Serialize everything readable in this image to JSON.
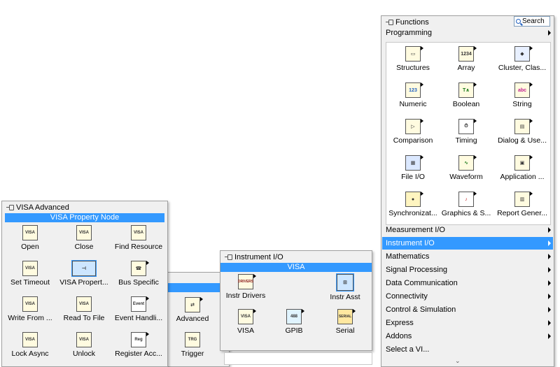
{
  "functions": {
    "title": "Functions",
    "search_label": "Search",
    "section": "Programming",
    "programming_items": [
      {
        "label": "Structures",
        "icon": "structures-icon"
      },
      {
        "label": "Array",
        "icon": "array-icon"
      },
      {
        "label": "Cluster, Clas...",
        "icon": "cluster-icon"
      },
      {
        "label": "Numeric",
        "icon": "numeric-icon"
      },
      {
        "label": "Boolean",
        "icon": "boolean-icon"
      },
      {
        "label": "String",
        "icon": "string-icon"
      },
      {
        "label": "Comparison",
        "icon": "comparison-icon"
      },
      {
        "label": "Timing",
        "icon": "timing-icon"
      },
      {
        "label": "Dialog & Use...",
        "icon": "dialog-icon"
      },
      {
        "label": "File I/O",
        "icon": "file-io-icon"
      },
      {
        "label": "Waveform",
        "icon": "waveform-icon"
      },
      {
        "label": "Application ...",
        "icon": "application-icon"
      },
      {
        "label": "Synchronizat...",
        "icon": "synchronization-icon"
      },
      {
        "label": "Graphics & S...",
        "icon": "graphics-icon"
      },
      {
        "label": "Report Gener...",
        "icon": "report-icon"
      }
    ],
    "categories": [
      "Measurement I/O",
      "Instrument I/O",
      "Mathematics",
      "Signal Processing",
      "Data Communication",
      "Connectivity",
      "Control & Simulation",
      "Express",
      "Addons",
      "Select a VI..."
    ]
  },
  "instrument_io": {
    "title": "Instrument I/O",
    "selected": "VISA",
    "items": [
      {
        "label": "Instr Drivers",
        "glyph": "DRIVERS"
      },
      {
        "label": "Instr Asst",
        "glyph": ""
      },
      {
        "label": "VISA",
        "glyph": "VISA"
      },
      {
        "label": "GPIB",
        "glyph": "488"
      },
      {
        "label": "Serial",
        "glyph": "SERIAL"
      }
    ]
  },
  "visa_mid": {
    "items": [
      {
        "label": "Advanced",
        "glyph": "⇄"
      },
      {
        "label": "Trigger",
        "glyph": "TRG"
      }
    ]
  },
  "visa_advanced": {
    "title": "VISA Advanced",
    "selected": "VISA Property Node",
    "items": [
      {
        "label": "Open",
        "glyph": "VISA"
      },
      {
        "label": "Close",
        "glyph": "VISA"
      },
      {
        "label": "Find Resource",
        "glyph": "VISA"
      },
      {
        "label": "Set Timeout",
        "glyph": "VISA"
      },
      {
        "label": "VISA Propert...",
        "glyph": "⊣"
      },
      {
        "label": "Bus Specific",
        "glyph": "☎"
      },
      {
        "label": "Write From ...",
        "glyph": "VISA"
      },
      {
        "label": "Read To File",
        "glyph": "VISA"
      },
      {
        "label": "Event Handli...",
        "glyph": "Event"
      },
      {
        "label": "Lock Async",
        "glyph": "VISA"
      },
      {
        "label": "Unlock",
        "glyph": "VISA"
      },
      {
        "label": "Register Acc...",
        "glyph": "Reg"
      }
    ]
  }
}
